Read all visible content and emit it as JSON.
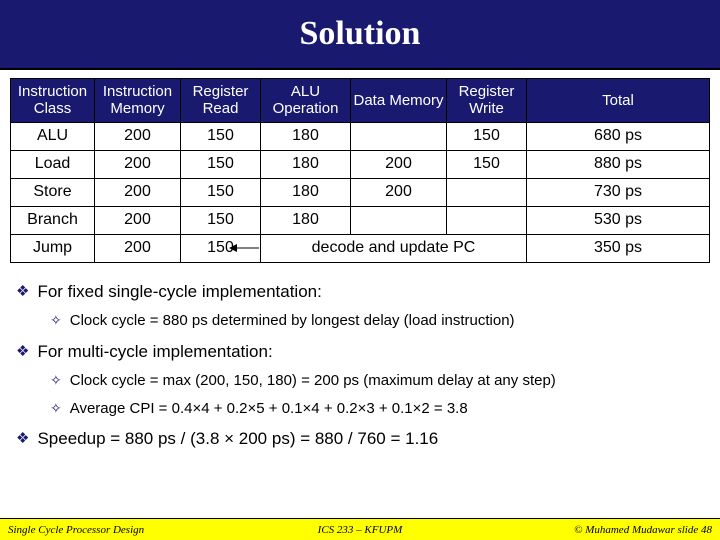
{
  "title": "Solution",
  "table": {
    "headers": [
      "Instruction Class",
      "Instruction Memory",
      "Register Read",
      "ALU Operation",
      "Data Memory",
      "Register Write",
      "Total"
    ],
    "rows": [
      {
        "class": "ALU",
        "imem": "200",
        "rread": "150",
        "alu": "180",
        "dmem": "",
        "rwrite": "150",
        "total": "680 ps"
      },
      {
        "class": "Load",
        "imem": "200",
        "rread": "150",
        "alu": "180",
        "dmem": "200",
        "rwrite": "150",
        "total": "880 ps"
      },
      {
        "class": "Store",
        "imem": "200",
        "rread": "150",
        "alu": "180",
        "dmem": "200",
        "rwrite": "",
        "total": "730 ps"
      },
      {
        "class": "Branch",
        "imem": "200",
        "rread": "150",
        "alu": "180",
        "dmem": "",
        "rwrite": "",
        "total": "530 ps"
      },
      {
        "class": "Jump",
        "imem": "200",
        "rread": "150",
        "alu": "",
        "decode": "decode and update PC",
        "total": "350 ps"
      }
    ]
  },
  "bullets": {
    "b1": "For fixed single-cycle implementation:",
    "b1a": "Clock cycle = 880 ps determined by longest delay (load instruction)",
    "b2": "For multi-cycle implementation:",
    "b2a": "Clock cycle = max (200, 150, 180) = 200 ps (maximum delay at any step)",
    "b2b": "Average CPI = 0.4×4 + 0.2×5 + 0.1×4 + 0.2×3 + 0.1×2 = 3.8",
    "b3": "Speedup = 880 ps / (3.8 × 200 ps) = 880 / 760 = 1.16"
  },
  "footer": {
    "left": "Single Cycle Processor Design",
    "center": "ICS 233 – KFUPM",
    "right": "© Muhamed Mudawar slide 48"
  }
}
